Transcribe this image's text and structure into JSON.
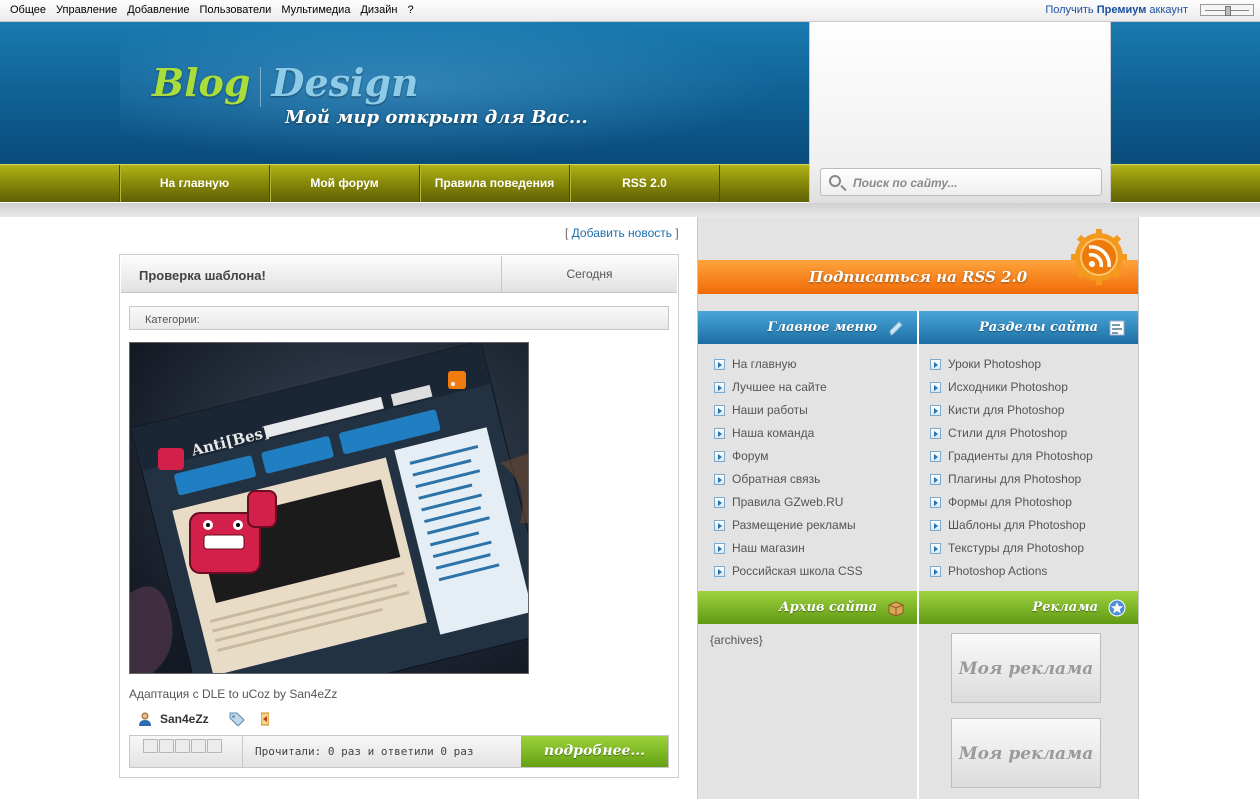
{
  "topbar": {
    "menu": [
      "Общее",
      "Управление",
      "Добавление",
      "Пользователи",
      "Мультимедиа",
      "Дизайн",
      "?"
    ],
    "premium_prefix": "Получить",
    "premium_bold": "Премиум",
    "premium_suffix": "аккаунт"
  },
  "header": {
    "logo_part1": "Blog",
    "logo_part2": "Design",
    "slogan": "Мой мир открыт для Вас..."
  },
  "nav": {
    "items": [
      "На главную",
      "Мой форум",
      "Правила поведения",
      "RSS 2.0"
    ]
  },
  "search": {
    "placeholder": "Поиск по сайту..."
  },
  "main": {
    "add_news_label": "Добавить новость",
    "post": {
      "title": "Проверка шаблона!",
      "date": "Сегодня",
      "categories_label": "Категории:",
      "caption": "Адаптация с DLE to uCoz by San4eZz",
      "author": "San4eZz",
      "stats": "Прочитали: 0 раз и ответили 0 раз",
      "more_label": "подробнее..."
    }
  },
  "sidebar": {
    "rss_label": "Подписаться на RSS 2.0",
    "main_menu": {
      "title": "Главное меню",
      "items": [
        "На главную",
        "Лучшее на сайте",
        "Наши работы",
        "Наша команда",
        "Форум",
        "Обратная связь",
        "Правила GZweb.RU",
        "Размещение рекламы",
        "Наш магазин",
        "Российская школа CSS"
      ]
    },
    "sections": {
      "title": "Разделы сайта",
      "items": [
        "Уроки Photoshop",
        "Исходники Photoshop",
        "Кисти для Photoshop",
        "Стили для Photoshop",
        "Градиенты для Photoshop",
        "Плагины для Photoshop",
        "Формы для Photoshop",
        "Шаблоны для Photoshop",
        "Текстуры для Photoshop",
        "Photoshop Actions"
      ]
    },
    "archive": {
      "title": "Архив сайта",
      "content": "{archives}"
    },
    "ads": {
      "title": "Реклама",
      "items": [
        "Моя реклама",
        "Моя реклама"
      ]
    }
  },
  "colors": {
    "header_blue": "#0f5f93",
    "nav_olive": "#8a8b08",
    "rss_orange": "#f06b08",
    "sidebar_blue": "#1c6ea3",
    "sidebar_green": "#5f9a14"
  }
}
